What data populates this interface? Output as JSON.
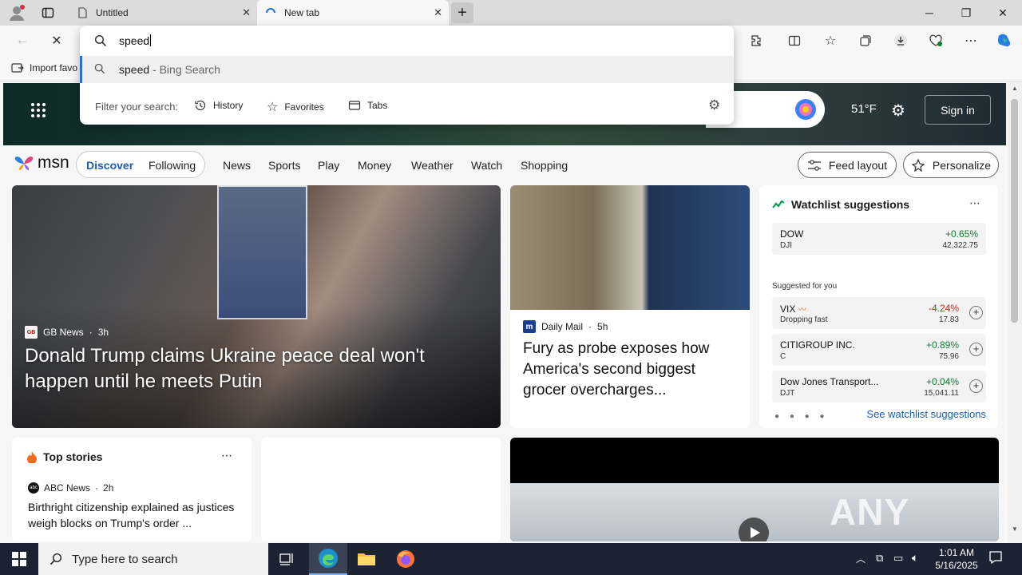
{
  "tabs": [
    {
      "title": "Untitled"
    },
    {
      "title": "New tab"
    }
  ],
  "omnibox": {
    "query": "speed",
    "suggestion_main": "speed",
    "suggestion_suffix": " - Bing Search",
    "filter_label": "Filter your search:",
    "filters": [
      "History",
      "Favorites",
      "Tabs"
    ]
  },
  "favorites_bar": {
    "import_label": "Import favo"
  },
  "msn_header": {
    "temperature": "51°F",
    "sign_in": "Sign in"
  },
  "msn_nav": {
    "logo": "msn",
    "pills": [
      "Discover",
      "Following"
    ],
    "links": [
      "News",
      "Sports",
      "Play",
      "Money",
      "Weather",
      "Watch",
      "Shopping"
    ],
    "feed_layout": "Feed layout",
    "personalize": "Personalize"
  },
  "hero": {
    "source": "GB News",
    "age": "3h",
    "headline": "Donald Trump claims Ukraine peace deal won't happen until he meets Putin"
  },
  "card2": {
    "source": "Daily Mail",
    "age": "5h",
    "headline": "Fury as probe exposes how America's second biggest grocer overcharges..."
  },
  "watchlist": {
    "title": "Watchlist suggestions",
    "top": {
      "symbol": "DOW",
      "sub": "DJI",
      "change": "+0.65%",
      "price": "42,322.75"
    },
    "suggested_label": "Suggested for you",
    "rows": [
      {
        "symbol": "VIX",
        "sub": "Dropping fast",
        "change": "-4.24%",
        "price": "17.83"
      },
      {
        "symbol": "CITIGROUP INC.",
        "sub": "C",
        "change": "+0.89%",
        "price": "75.96"
      },
      {
        "symbol": "Dow Jones Transport...",
        "sub": "DJT",
        "change": "+0.04%",
        "price": "15,041.11"
      }
    ],
    "see_all": "See watchlist suggestions"
  },
  "top_stories": {
    "title": "Top stories",
    "source": "ABC News",
    "age": "2h",
    "headline": "Birthright citizenship explained as justices weigh blocks on Trump's order ..."
  },
  "video": {
    "watermark": "ANY RUN"
  },
  "taskbar": {
    "search_placeholder": "Type here to search",
    "time": "1:01 AM",
    "date": "5/16/2025"
  },
  "colors": {
    "accent": "#2d6fcf",
    "up": "#0f7b30",
    "down": "#c42b1c",
    "taskbar": "#1c2433"
  }
}
